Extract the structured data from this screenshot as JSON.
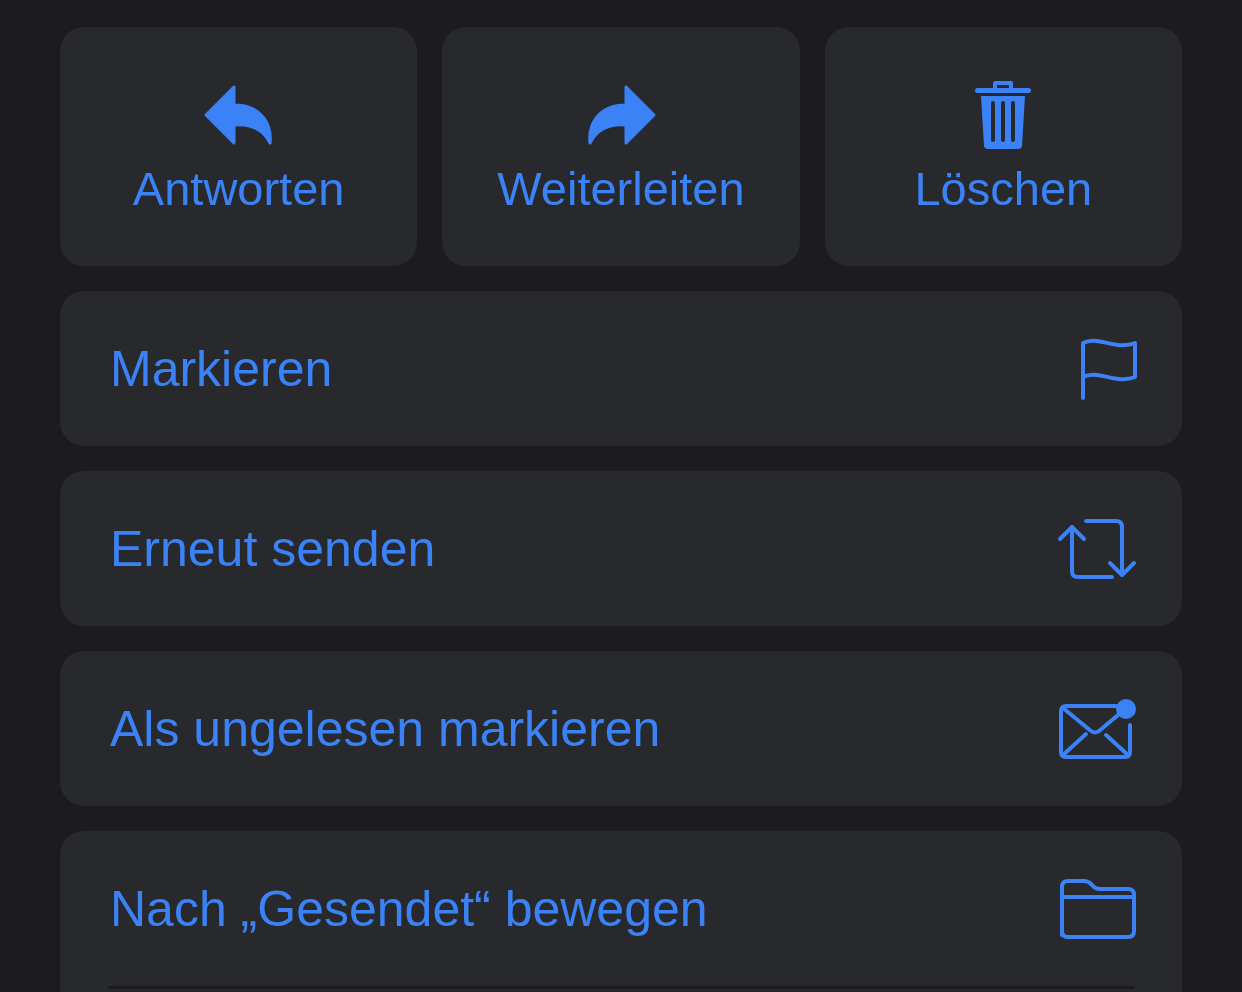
{
  "quick_actions": [
    {
      "kind": "reply",
      "label": "Antworten"
    },
    {
      "kind": "forward",
      "label": "Weiterleiten"
    },
    {
      "kind": "trash",
      "label": "Löschen"
    }
  ],
  "menu_items": [
    {
      "kind": "flag",
      "label": "Markieren"
    },
    {
      "kind": "resend",
      "label": "Erneut senden"
    },
    {
      "kind": "unread",
      "label": "Als ungelesen markieren"
    },
    {
      "kind": "move",
      "label": "Nach „Gesendet“ bewegen"
    }
  ]
}
